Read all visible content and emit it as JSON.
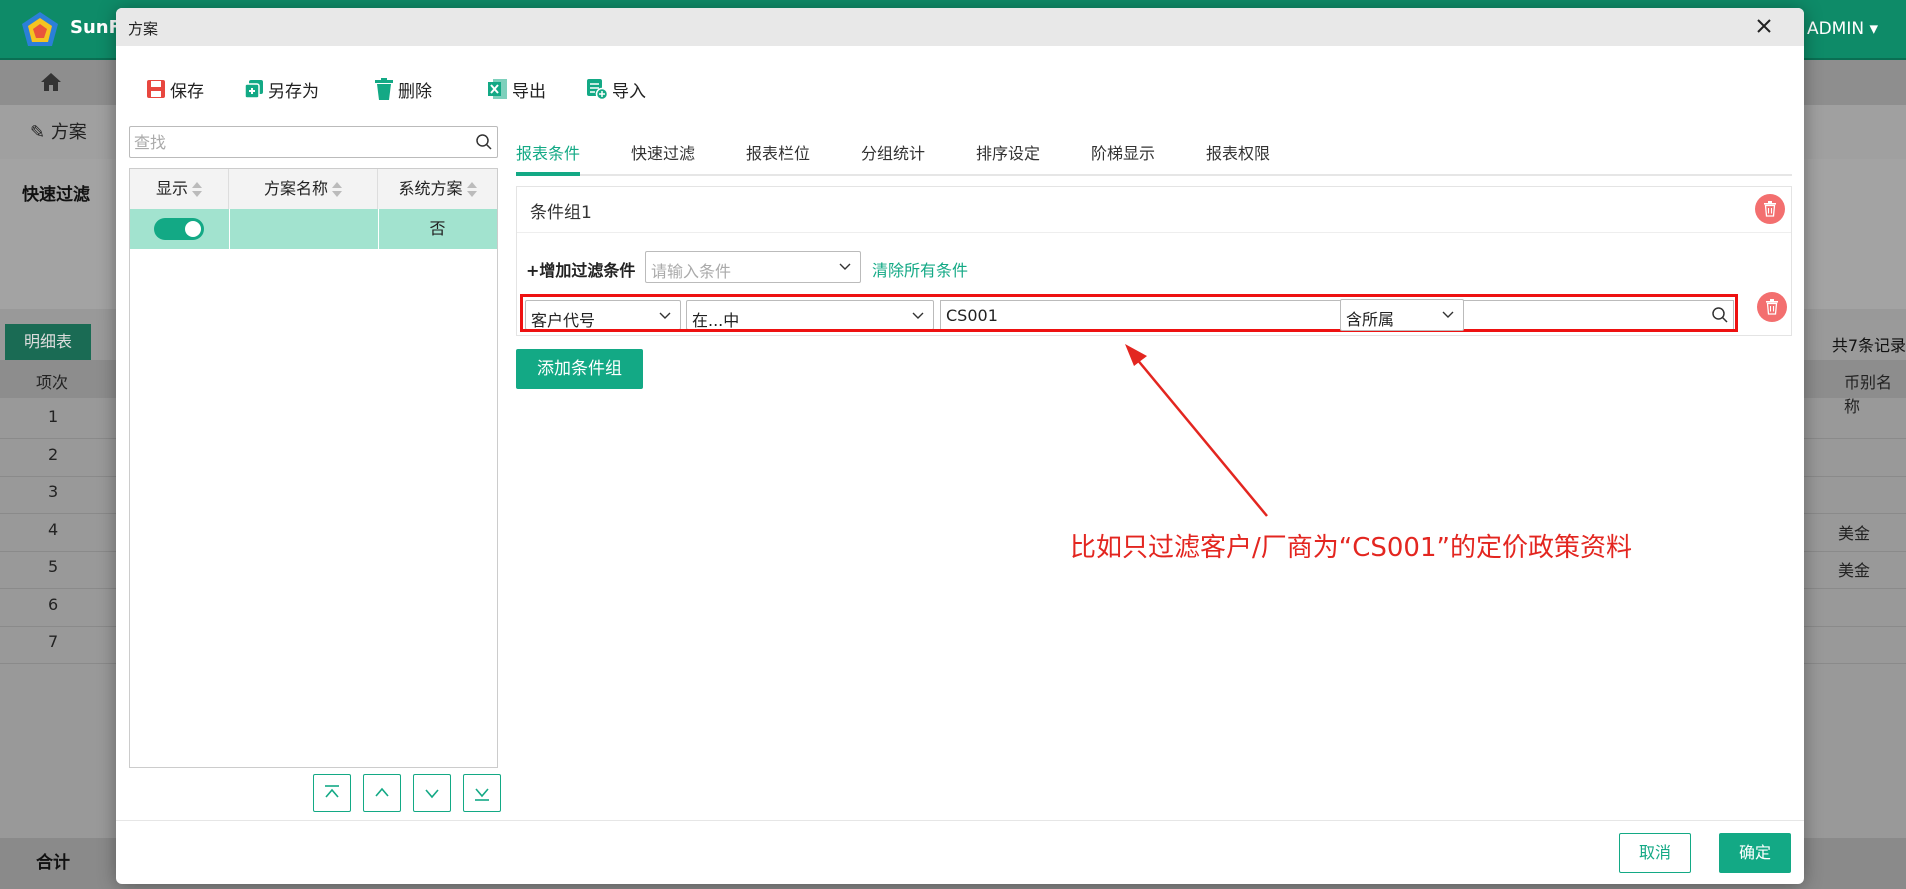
{
  "app": {
    "logo_text": "SunFu",
    "user": "ADMIN ▾",
    "nav": {
      "scheme_label": "方案"
    },
    "quick_filter_label": "快速过滤",
    "tabs": {
      "active": "明细表"
    },
    "total_count": "共7条记录",
    "table": {
      "col_item": "项次",
      "col_currency": "币别名称",
      "rows": [
        {
          "no": "1",
          "currency": ""
        },
        {
          "no": "2",
          "currency": ""
        },
        {
          "no": "3",
          "currency": ""
        },
        {
          "no": "4",
          "currency": "美金"
        },
        {
          "no": "5",
          "currency": "美金"
        },
        {
          "no": "6",
          "currency": ""
        },
        {
          "no": "7",
          "currency": ""
        }
      ]
    },
    "footer_sum": "合计"
  },
  "modal": {
    "title": "方案",
    "toolbar": {
      "save": "保存",
      "save_as": "另存为",
      "delete": "删除",
      "export": "导出",
      "import": "导入"
    },
    "search": {
      "placeholder": "查找"
    },
    "scheme_list": {
      "headers": {
        "show": "显示",
        "name": "方案名称",
        "system": "系统方案"
      },
      "rows": [
        {
          "show": true,
          "name": "",
          "system": "否"
        }
      ]
    },
    "tabs": [
      "报表条件",
      "快速过滤",
      "报表栏位",
      "分组统计",
      "排序设定",
      "阶梯显示",
      "报表权限"
    ],
    "active_tab": "报表条件",
    "condition_group": {
      "title": "条件组1",
      "add_filter_label": "+增加过滤条件",
      "condition_placeholder": "请输入条件",
      "clear_all": "清除所有条件",
      "condition": {
        "field": "客户代号",
        "operator": "在...中",
        "value": "CS001",
        "scope": "含所属"
      }
    },
    "add_group": "添加条件组",
    "annotation": "比如只过滤客户/厂商为“CS001”的定价政策资料",
    "footer": {
      "cancel": "取消",
      "ok": "确定"
    }
  },
  "colors": {
    "brand": "#13a985",
    "danger": "#f36f6f",
    "annotation": "#e32620",
    "highlight_row": "#a2e3cf"
  }
}
